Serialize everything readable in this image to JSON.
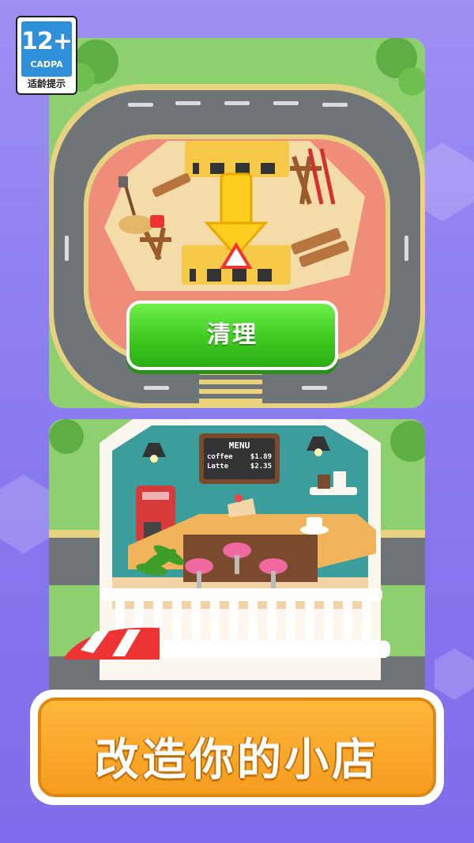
{
  "age_rating": {
    "number": "12+",
    "org": "CADPA",
    "hint": "适龄提示"
  },
  "top_panel": {
    "clean_button_label": "清理"
  },
  "bottom_panel": {
    "menu": {
      "title": "MENU",
      "items": [
        {
          "name": "coffee",
          "price": "$1.89"
        },
        {
          "name": "Latte",
          "price": "$2.35"
        }
      ]
    }
  },
  "slogan": "改造你的小店",
  "colors": {
    "background": "#8c7cf0",
    "button": "#3cc61f",
    "slogan_box": "#f59c1f"
  }
}
